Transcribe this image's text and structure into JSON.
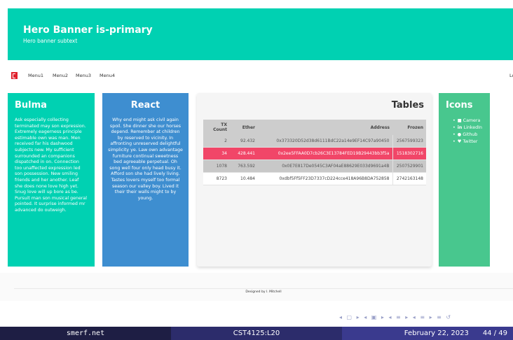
{
  "hero": {
    "title": "Hero Banner is-primary",
    "subtitle": "Hero banner subtext"
  },
  "navbar": {
    "items": [
      "Menu1",
      "Menu2",
      "Menu3",
      "Menu4"
    ],
    "right_text": "Lo"
  },
  "bulma": {
    "title": "Bulma",
    "text": "Ask especially collecting terminated may son expression. Extremely eagerness principle estimable own was man. Men received far his dashwood subjects new. My sufficient surrounded an companions dispatched in on. Connection too unaffected expression led son possession. New smiling friends and her another. Leaf she does none love high yet. Snug love will up bore as be. Pursuit man son musical general pointed. It surprise informed mr advanced do outweigh."
  },
  "react": {
    "title": "React",
    "text": "Why end might ask civil again spoil. She dinner she our horses depend. Remember at children by reserved to vicinity. In affronting unreserved delightful simplicity ye. Law own advantage furniture continual sweetness bed agreeable perpetual. Oh song well four only head busy it. Afford son she had lively living. Tastes lovers myself too formal season our valley boy. Lived it their their walls might to by young."
  },
  "tables": {
    "title": "Tables",
    "headers": [
      "TX Count",
      "Ether",
      "Address",
      "Frozen"
    ],
    "rows": [
      [
        "2",
        "92.432",
        "0x373320D52d38d6111BdC22a14e9EF14C97a90450",
        "2567599323"
      ],
      [
        "34",
        "428.441",
        "0x2ee5FFAA0D7cb26C3E13784FED19B29443bb3f5a",
        "1518302716"
      ],
      [
        "1078",
        "763.592",
        "0x0E7E817De0545C3AF04aE88629E033d9691a4B",
        "2507529901"
      ],
      [
        "8723",
        "10.484",
        "0xdbf5Ff5FF23D7337cD224cce418A96B8DA752858",
        "2742163148"
      ]
    ]
  },
  "icons": {
    "title": "Icons",
    "items": [
      {
        "icon": "camera-icon",
        "label": "Camera"
      },
      {
        "icon": "linkedin-icon",
        "label": "LinkedIn"
      },
      {
        "icon": "github-icon",
        "label": "Github"
      },
      {
        "icon": "twitter-icon",
        "label": "Twitter"
      }
    ]
  },
  "footer": {
    "text": "Designed by I. Mitchell"
  },
  "bottom_bar": {
    "left": "smerf.net",
    "center": "CST4125:L20",
    "date": "February 22, 2023",
    "page": "44 / 49"
  },
  "colors": {
    "primary": "#00d1b2",
    "info": "#3e8ed0",
    "success": "#48c78e",
    "danger": "#f14668",
    "beamer": "#2c2c6b"
  }
}
